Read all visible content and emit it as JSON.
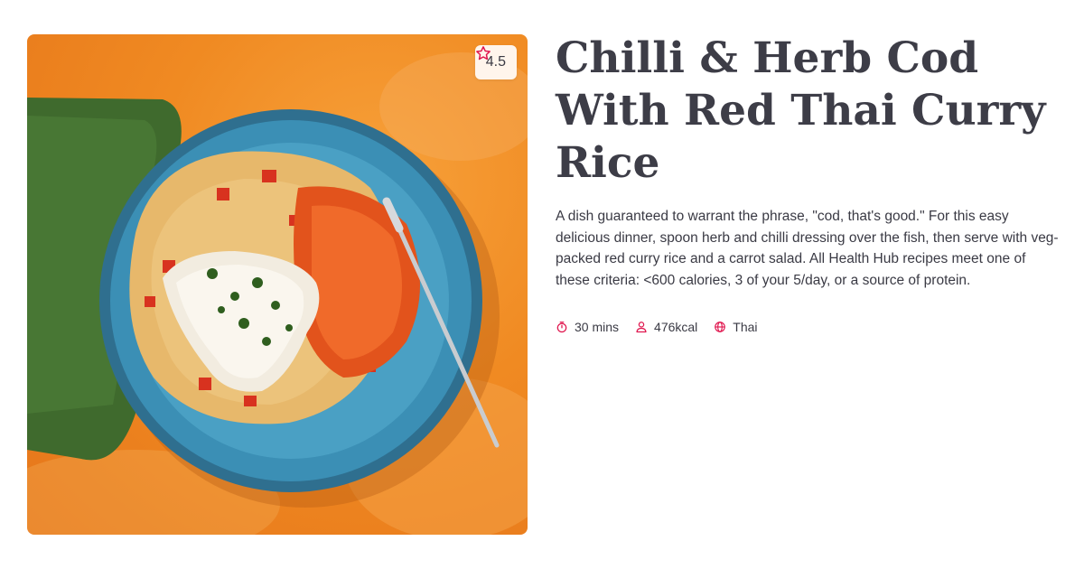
{
  "recipe": {
    "title": "Chilli & Herb Cod With Red Thai Curry Rice",
    "description": "A dish guaranteed to warrant the phrase, \"cod, that's good.\" For this easy delicious dinner, spoon herb and chilli dressing over the fish, then serve with veg-packed red curry rice and a carrot salad. All Health Hub recipes meet one of these criteria: <600 calories, 3 of your 5/day, or a source of protein.",
    "rating": "4.5",
    "meta": {
      "time": "30 mins",
      "calories": "476kcal",
      "cuisine": "Thai"
    }
  },
  "icons": {
    "rating": "star-outline-icon",
    "time": "stopwatch-icon",
    "calories": "person-icon",
    "cuisine": "globe-icon"
  },
  "colors": {
    "accent": "#e0174f",
    "title": "#3d3d47",
    "background_orange": "#f08a22",
    "plate_blue": "#3b8fb5"
  }
}
